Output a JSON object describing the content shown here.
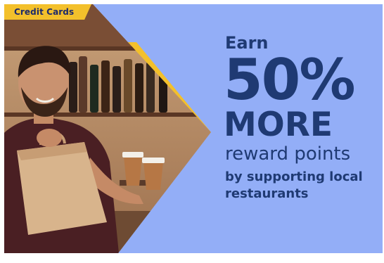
{
  "tag": {
    "label": "Credit Cards"
  },
  "headline": {
    "earn": "Earn",
    "percent": "50%",
    "more": "MORE",
    "reward": "reward points",
    "support_line1": "by supporting local",
    "support_line2": "restaurants"
  },
  "colors": {
    "background": "#93aef7",
    "accent": "#f3c02b",
    "text": "#1f3a73"
  },
  "icons": {
    "tag_shape": "ribbon-tag",
    "photo": "server-handing-takeout-bag-and-coffee"
  }
}
